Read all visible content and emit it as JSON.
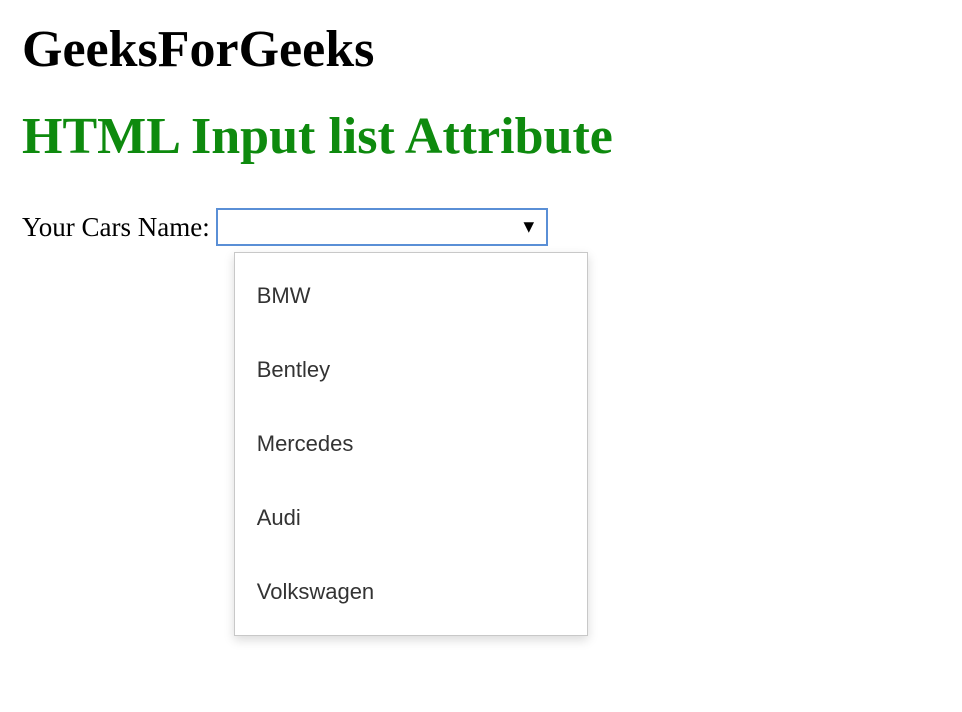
{
  "site_title": "GeeksForGeeks",
  "page_title": "HTML Input list Attribute",
  "form": {
    "label": "Your Cars Name:",
    "value": "",
    "options": [
      "BMW",
      "Bentley",
      "Mercedes",
      "Audi",
      "Volkswagen"
    ]
  }
}
